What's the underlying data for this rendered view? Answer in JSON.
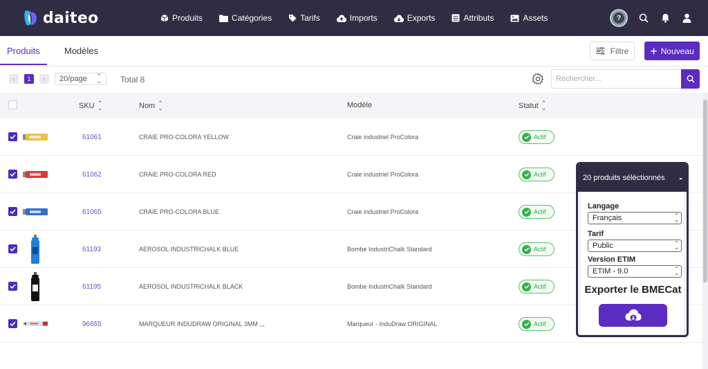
{
  "app": {
    "logo_text": "daiteo"
  },
  "nav": {
    "items": [
      {
        "label": "Produits",
        "icon": "box-icon"
      },
      {
        "label": "Catégories",
        "icon": "folder-icon"
      },
      {
        "label": "Tarifs",
        "icon": "tag-icon"
      },
      {
        "label": "Imports",
        "icon": "cloud-upload-icon"
      },
      {
        "label": "Exports",
        "icon": "cloud-download-icon"
      },
      {
        "label": "Attributs",
        "icon": "list-icon"
      },
      {
        "label": "Assets",
        "icon": "image-icon"
      }
    ],
    "help": "?"
  },
  "tabs": [
    {
      "label": "Produits",
      "active": true
    },
    {
      "label": "Modèles",
      "active": false
    }
  ],
  "actions": {
    "filter": "Filtre",
    "new": "Nouveau"
  },
  "toolbar": {
    "page": "1",
    "per_page": "20/page",
    "total": "Total 8",
    "search_placeholder": "Rechercher..."
  },
  "table": {
    "columns": {
      "sku": "SKU",
      "name": "Nom",
      "model": "Modèle",
      "status": "Statut"
    },
    "rows": [
      {
        "sku": "61061",
        "name": "CRAIE PRO-COLORA YELLOW",
        "model": "Craie industriel ProColora",
        "status": "Actif",
        "checked": true,
        "thumb": "#e8c246"
      },
      {
        "sku": "61062",
        "name": "CRAIE PRO-COLORA RED",
        "model": "Craie industriel ProColora",
        "status": "Actif",
        "checked": true,
        "thumb": "#d83a3a"
      },
      {
        "sku": "61065",
        "name": "CRAIE PRO-COLORA BLUE",
        "model": "Craie industriel ProColora",
        "status": "Actif",
        "checked": true,
        "thumb": "#2f6fc9"
      },
      {
        "sku": "61193",
        "name": "AEROSOL INDUSTRICHALK BLUE",
        "model": "Bombe IndustriChalk Standard",
        "status": "Actif",
        "checked": true,
        "thumb": "#1f7fd6"
      },
      {
        "sku": "61195",
        "name": "AEROSOL INDUSTRICHALK BLACK",
        "model": "Bombe IndustriChalk Standard",
        "status": "Actif",
        "checked": true,
        "thumb": "#111111"
      },
      {
        "sku": "96655",
        "name": "MARQUEUR INDUDRAW ORIGINAL 3MM ,,,",
        "model": "Marqueur - InduDraw ORIGINAL",
        "status": "Actif",
        "checked": true,
        "thumb": "#c23030"
      }
    ]
  },
  "panel": {
    "title": "20 produits séléctionnés",
    "collapse": "-",
    "fields": [
      {
        "label": "Langage",
        "value": "Français"
      },
      {
        "label": "Tarif",
        "value": "Public"
      },
      {
        "label": "Version ETIM",
        "value": "ETIM - 9.0"
      }
    ],
    "export_title": "Exporter le BMECat"
  },
  "colors": {
    "primary": "#5b2bc2",
    "topbar": "#2f2c44",
    "success": "#33b34a"
  }
}
